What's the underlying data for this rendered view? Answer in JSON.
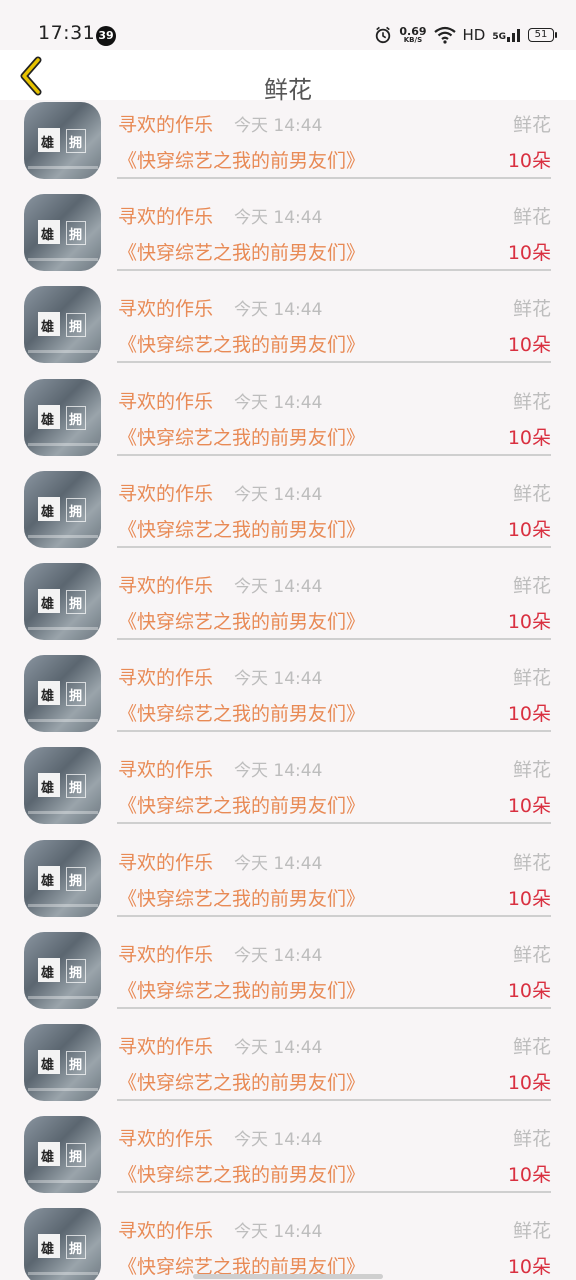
{
  "status_bar": {
    "time": "17:31",
    "notification_count": "39",
    "net_speed": "0.69",
    "net_speed_unit": "KB/S",
    "network_label": "HD",
    "cell_label": "5G",
    "battery": "51"
  },
  "header": {
    "title": "鲜花",
    "back_icon": "chevron-left-icon"
  },
  "colors": {
    "username": "#e88a55",
    "book_title": "#e88a55",
    "count": "#d93040",
    "secondary": "#bdbdbd",
    "back_arrow": "#e6c200"
  },
  "list": {
    "items": [
      {
        "avatar_text": [
          "雄",
          "拥"
        ],
        "username": "寻欢的作乐",
        "time": "今天 14:44",
        "gift_type": "鲜花",
        "book_title": "《快穿综艺之我的前男友们》",
        "count": "10朵"
      },
      {
        "avatar_text": [
          "雄",
          "拥"
        ],
        "username": "寻欢的作乐",
        "time": "今天 14:44",
        "gift_type": "鲜花",
        "book_title": "《快穿综艺之我的前男友们》",
        "count": "10朵"
      },
      {
        "avatar_text": [
          "雄",
          "拥"
        ],
        "username": "寻欢的作乐",
        "time": "今天 14:44",
        "gift_type": "鲜花",
        "book_title": "《快穿综艺之我的前男友们》",
        "count": "10朵"
      },
      {
        "avatar_text": [
          "雄",
          "拥"
        ],
        "username": "寻欢的作乐",
        "time": "今天 14:44",
        "gift_type": "鲜花",
        "book_title": "《快穿综艺之我的前男友们》",
        "count": "10朵"
      },
      {
        "avatar_text": [
          "雄",
          "拥"
        ],
        "username": "寻欢的作乐",
        "time": "今天 14:44",
        "gift_type": "鲜花",
        "book_title": "《快穿综艺之我的前男友们》",
        "count": "10朵"
      },
      {
        "avatar_text": [
          "雄",
          "拥"
        ],
        "username": "寻欢的作乐",
        "time": "今天 14:44",
        "gift_type": "鲜花",
        "book_title": "《快穿综艺之我的前男友们》",
        "count": "10朵"
      },
      {
        "avatar_text": [
          "雄",
          "拥"
        ],
        "username": "寻欢的作乐",
        "time": "今天 14:44",
        "gift_type": "鲜花",
        "book_title": "《快穿综艺之我的前男友们》",
        "count": "10朵"
      },
      {
        "avatar_text": [
          "雄",
          "拥"
        ],
        "username": "寻欢的作乐",
        "time": "今天 14:44",
        "gift_type": "鲜花",
        "book_title": "《快穿综艺之我的前男友们》",
        "count": "10朵"
      },
      {
        "avatar_text": [
          "雄",
          "拥"
        ],
        "username": "寻欢的作乐",
        "time": "今天 14:44",
        "gift_type": "鲜花",
        "book_title": "《快穿综艺之我的前男友们》",
        "count": "10朵"
      },
      {
        "avatar_text": [
          "雄",
          "拥"
        ],
        "username": "寻欢的作乐",
        "time": "今天 14:44",
        "gift_type": "鲜花",
        "book_title": "《快穿综艺之我的前男友们》",
        "count": "10朵"
      },
      {
        "avatar_text": [
          "雄",
          "拥"
        ],
        "username": "寻欢的作乐",
        "time": "今天 14:44",
        "gift_type": "鲜花",
        "book_title": "《快穿综艺之我的前男友们》",
        "count": "10朵"
      },
      {
        "avatar_text": [
          "雄",
          "拥"
        ],
        "username": "寻欢的作乐",
        "time": "今天 14:44",
        "gift_type": "鲜花",
        "book_title": "《快穿综艺之我的前男友们》",
        "count": "10朵"
      },
      {
        "avatar_text": [
          "雄",
          "拥"
        ],
        "username": "寻欢的作乐",
        "time": "今天 14:44",
        "gift_type": "鲜花",
        "book_title": "《快穿综艺之我的前男友们》",
        "count": "10朵"
      }
    ]
  }
}
